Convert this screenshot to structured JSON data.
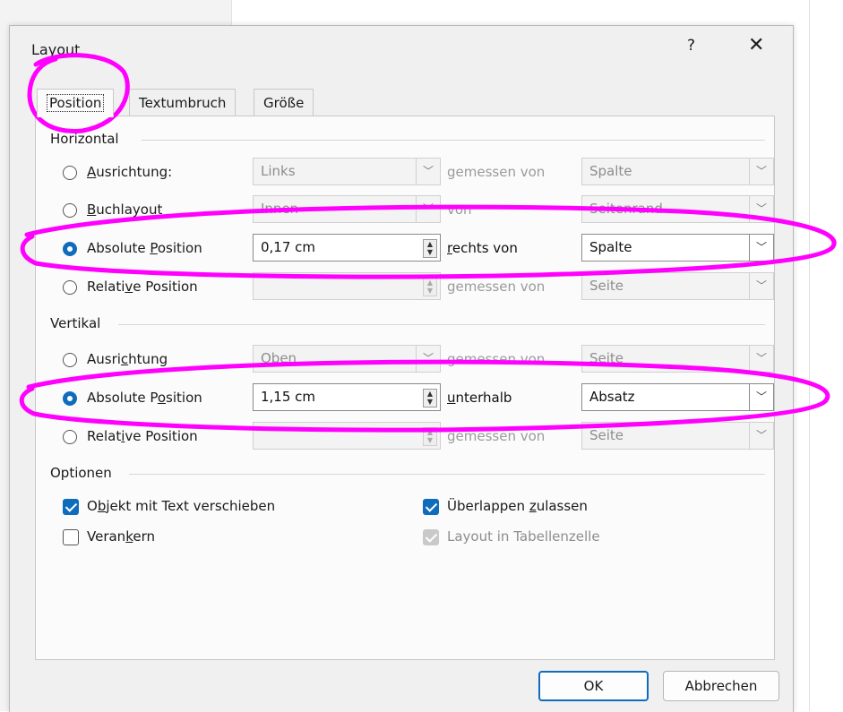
{
  "dialog": {
    "title": "Layout",
    "help": "?",
    "close": "✕"
  },
  "tabs": [
    {
      "label": "Position"
    },
    {
      "label": "Textumbruch"
    },
    {
      "label": "Größe"
    }
  ],
  "horizontal": {
    "section": "Horizontal",
    "rows": [
      {
        "label_pre": "",
        "label_u": "A",
        "label_post": "usrichtung:",
        "value": "Links",
        "mid": "gemessen von",
        "mid_u": "",
        "mid_post": "",
        "ref": "Spalte"
      },
      {
        "label_pre": "",
        "label_u": "B",
        "label_post": "uchlayout",
        "value": "Innen",
        "mid": "von",
        "mid_u": "",
        "mid_post": "",
        "ref": "Seitenrand"
      },
      {
        "label_pre": "Absolute ",
        "label_u": "P",
        "label_post": "osition",
        "value": "0,17 cm",
        "mid": "",
        "mid_u": "r",
        "mid_post": "echts von",
        "ref": "Spalte"
      },
      {
        "label_pre": "Relati",
        "label_u": "v",
        "label_post": "e Position",
        "value": "",
        "mid": "gemessen von",
        "mid_u": "",
        "mid_post": "",
        "ref": "Seite"
      }
    ]
  },
  "vertical": {
    "section": "Vertikal",
    "rows": [
      {
        "label_pre": "Ausri",
        "label_u": "c",
        "label_post": "htung",
        "value": "Oben",
        "mid": "gemessen von",
        "mid_u": "",
        "mid_post": "",
        "ref": "Seite"
      },
      {
        "label_pre": "Absolute P",
        "label_u": "o",
        "label_post": "sition",
        "value": "1,15 cm",
        "mid": "",
        "mid_u": "u",
        "mid_post": "nterhalb",
        "ref": "Absatz"
      },
      {
        "label_pre": "Relat",
        "label_u": "i",
        "label_post": "ve Position",
        "value": "",
        "mid": "gemessen von",
        "mid_u": "",
        "mid_post": "",
        "ref": "Seite"
      }
    ]
  },
  "options": {
    "section": "Optionen",
    "move_pre": "O",
    "move_u": "b",
    "move_post": "jekt mit Text verschieben",
    "anchor_pre": "Veran",
    "anchor_u": "k",
    "anchor_post": "ern",
    "overlap_pre": "Überlappen ",
    "overlap_u": "z",
    "overlap_post": "ulassen",
    "table_cell": "Layout in Tabellenzelle"
  },
  "buttons": {
    "ok": "OK",
    "cancel": "Abbrechen"
  },
  "colors": {
    "accent": "#0f6cbd",
    "annotation": "#ff00ff"
  }
}
